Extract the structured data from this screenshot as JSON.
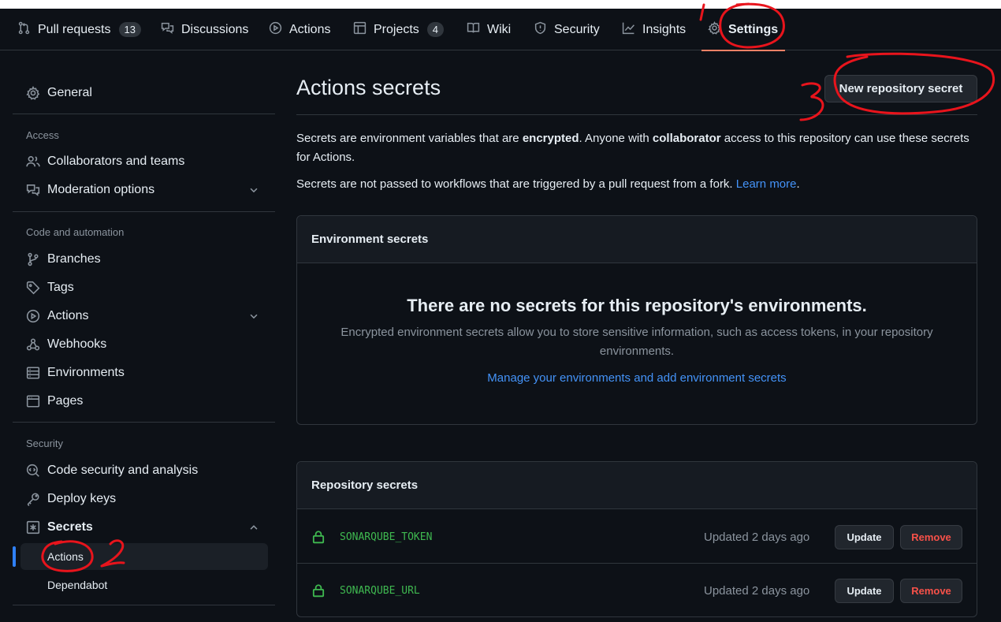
{
  "top_nav": {
    "tabs": [
      {
        "label": "Pull requests",
        "count": "13",
        "icon": "git-pull-request-icon"
      },
      {
        "label": "Discussions",
        "icon": "comment-discussion-icon"
      },
      {
        "label": "Actions",
        "icon": "play-icon"
      },
      {
        "label": "Projects",
        "count": "4",
        "icon": "table-icon"
      },
      {
        "label": "Wiki",
        "icon": "book-icon"
      },
      {
        "label": "Security",
        "icon": "shield-icon"
      },
      {
        "label": "Insights",
        "icon": "graph-icon"
      },
      {
        "label": "Settings",
        "icon": "gear-icon",
        "selected": true
      }
    ]
  },
  "sidebar": {
    "general": "General",
    "sections": [
      {
        "heading": "Access",
        "items": [
          "Collaborators and teams",
          "Moderation options"
        ]
      },
      {
        "heading": "Code and automation",
        "items": [
          "Branches",
          "Tags",
          "Actions",
          "Webhooks",
          "Environments",
          "Pages"
        ]
      },
      {
        "heading": "Security",
        "items": [
          "Code security and analysis",
          "Deploy keys",
          "Secrets"
        ]
      }
    ],
    "secrets_sub": [
      "Actions",
      "Dependabot"
    ]
  },
  "main": {
    "title": "Actions secrets",
    "new_button": "New repository secret",
    "desc1_a": "Secrets are environment variables that are ",
    "desc1_b": "encrypted",
    "desc1_c": ". Anyone with ",
    "desc1_d": "collaborator",
    "desc1_e": " access to this repository can use these secrets for Actions.",
    "desc2_a": "Secrets are not passed to workflows that are triggered by a pull request from a fork. ",
    "desc2_link": "Learn more",
    "desc2_end": ".",
    "env_box": {
      "header": "Environment secrets",
      "blank_title": "There are no secrets for this repository's environments.",
      "blank_desc": "Encrypted environment secrets allow you to store sensitive information, such as access tokens, in your repository environments.",
      "blank_link": "Manage your environments and add environment secrets"
    },
    "repo_box": {
      "header": "Repository secrets",
      "rows": [
        {
          "name": "SONARQUBE_TOKEN",
          "updated": "Updated 2 days ago",
          "update": "Update",
          "remove": "Remove"
        },
        {
          "name": "SONARQUBE_URL",
          "updated": "Updated 2 days ago",
          "update": "Update",
          "remove": "Remove"
        }
      ]
    }
  },
  "annotations": {
    "n1": "1",
    "n2": "2",
    "n3": "3",
    "ink_color": "#e8141c"
  },
  "colors": {
    "bg": "#0d1117",
    "link": "#4493f8",
    "success": "#3fb950",
    "danger": "#f85149",
    "accent": "#f78166"
  }
}
